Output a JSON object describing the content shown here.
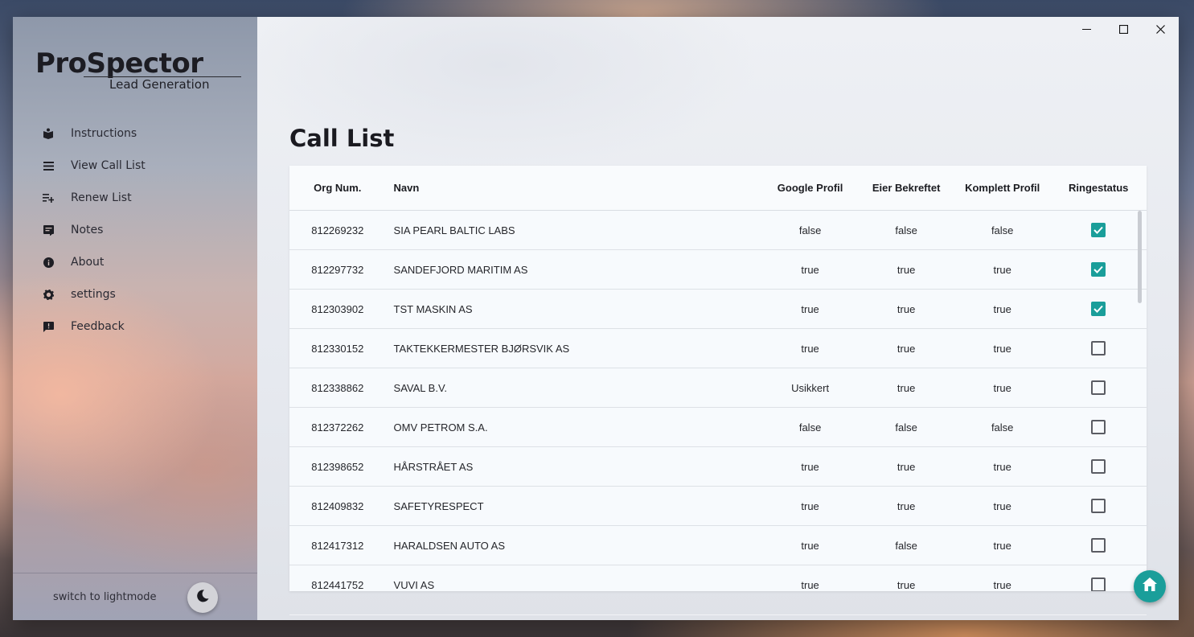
{
  "brand": {
    "title": "ProSpector",
    "subtitle": "Lead Generation"
  },
  "sidebar": {
    "items": [
      {
        "label": "Instructions",
        "icon": "book-icon"
      },
      {
        "label": "View Call List",
        "icon": "list-icon"
      },
      {
        "label": "Renew List",
        "icon": "playlist-add-icon"
      },
      {
        "label": "Notes",
        "icon": "notes-icon"
      },
      {
        "label": "About",
        "icon": "info-icon"
      },
      {
        "label": "settings",
        "icon": "gear-icon"
      },
      {
        "label": "Feedback",
        "icon": "feedback-icon"
      }
    ],
    "mode_label": "switch to lightmode"
  },
  "main": {
    "title": "Call List",
    "table": {
      "headers": [
        "Org Num.",
        "Navn",
        "Google Profil",
        "Eier Bekreftet",
        "Komplett Profil",
        "Ringestatus"
      ],
      "rows": [
        {
          "org": "812269232",
          "name": "SIA PEARL BALTIC LABS",
          "google": "false",
          "eier": "false",
          "komplett": "false",
          "ringestatus": true
        },
        {
          "org": "812297732",
          "name": "SANDEFJORD MARITIM AS",
          "google": "true",
          "eier": "true",
          "komplett": "true",
          "ringestatus": true
        },
        {
          "org": "812303902",
          "name": "TST MASKIN AS",
          "google": "true",
          "eier": "true",
          "komplett": "true",
          "ringestatus": true
        },
        {
          "org": "812330152",
          "name": "TAKTEKKERMESTER BJØRSVIK AS",
          "google": "true",
          "eier": "true",
          "komplett": "true",
          "ringestatus": false
        },
        {
          "org": "812338862",
          "name": "SAVAL B.V.",
          "google": "Usikkert",
          "eier": "true",
          "komplett": "true",
          "ringestatus": false
        },
        {
          "org": "812372262",
          "name": "OMV PETROM S.A.",
          "google": "false",
          "eier": "false",
          "komplett": "false",
          "ringestatus": false
        },
        {
          "org": "812398652",
          "name": "HÅRSTRÅET AS",
          "google": "true",
          "eier": "true",
          "komplett": "true",
          "ringestatus": false
        },
        {
          "org": "812409832",
          "name": "SAFETYRESPECT",
          "google": "true",
          "eier": "true",
          "komplett": "true",
          "ringestatus": false
        },
        {
          "org": "812417312",
          "name": "HARALDSEN AUTO AS",
          "google": "true",
          "eier": "false",
          "komplett": "true",
          "ringestatus": false
        },
        {
          "org": "812441752",
          "name": "VUVI AS",
          "google": "true",
          "eier": "true",
          "komplett": "true",
          "ringestatus": false
        }
      ]
    }
  },
  "colors": {
    "accent": "#1a9e9a"
  }
}
